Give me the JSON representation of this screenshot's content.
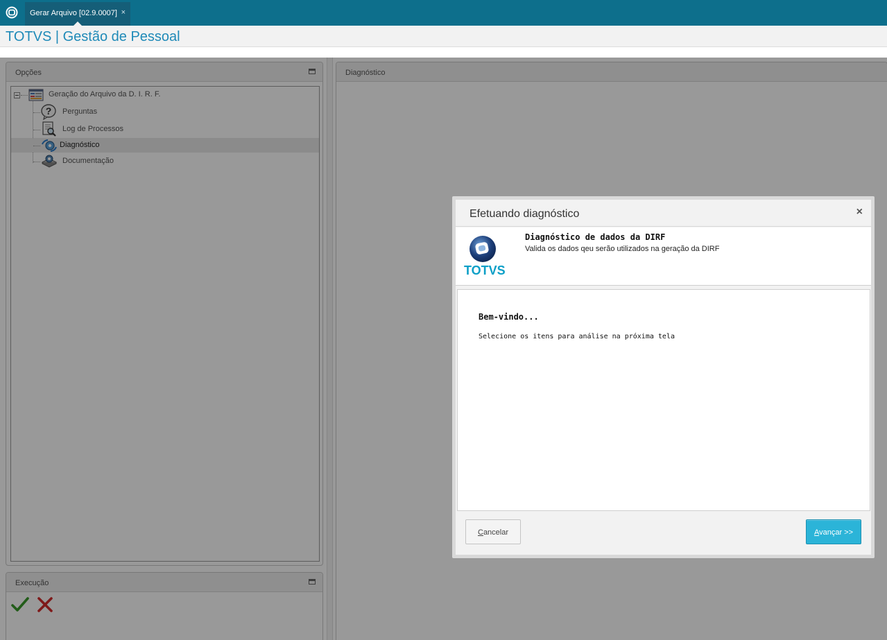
{
  "topbar": {
    "tab_label": "Gerar Arquivo [02.9.0007]",
    "tab_close": "×"
  },
  "app_title": "TOTVS | Gestão de Pessoal",
  "options_panel": {
    "title": "Opções",
    "tree": {
      "root": "Geração do Arquivo da D. I. R. F.",
      "items": [
        "Perguntas",
        "Log de Processos",
        "Diagnóstico",
        "Documentação"
      ],
      "selected": "Diagnóstico"
    }
  },
  "execution_panel": {
    "title": "Execução"
  },
  "diagnostic_panel": {
    "title": "Diagnóstico"
  },
  "modal": {
    "title": "Efetuando diagnóstico",
    "close": "×",
    "banner_title": "Diagnóstico de dados da DIRF",
    "banner_subtitle": "Valida os dados qeu serão utilizados na geração da DIRF",
    "logo_text": "TOTVS",
    "welcome": "Bem-vindo...",
    "welcome_text": "Selecione os itens para análise na próxima tela",
    "cancel_first": "C",
    "cancel_rest": "ancelar",
    "next_first": "A",
    "next_rest": "vançar >>"
  },
  "colors": {
    "topbar": "#0d6f8c",
    "title": "#1f8ab8",
    "primary_button": "#2bb4d8",
    "logo_text": "#0b9fc7"
  }
}
